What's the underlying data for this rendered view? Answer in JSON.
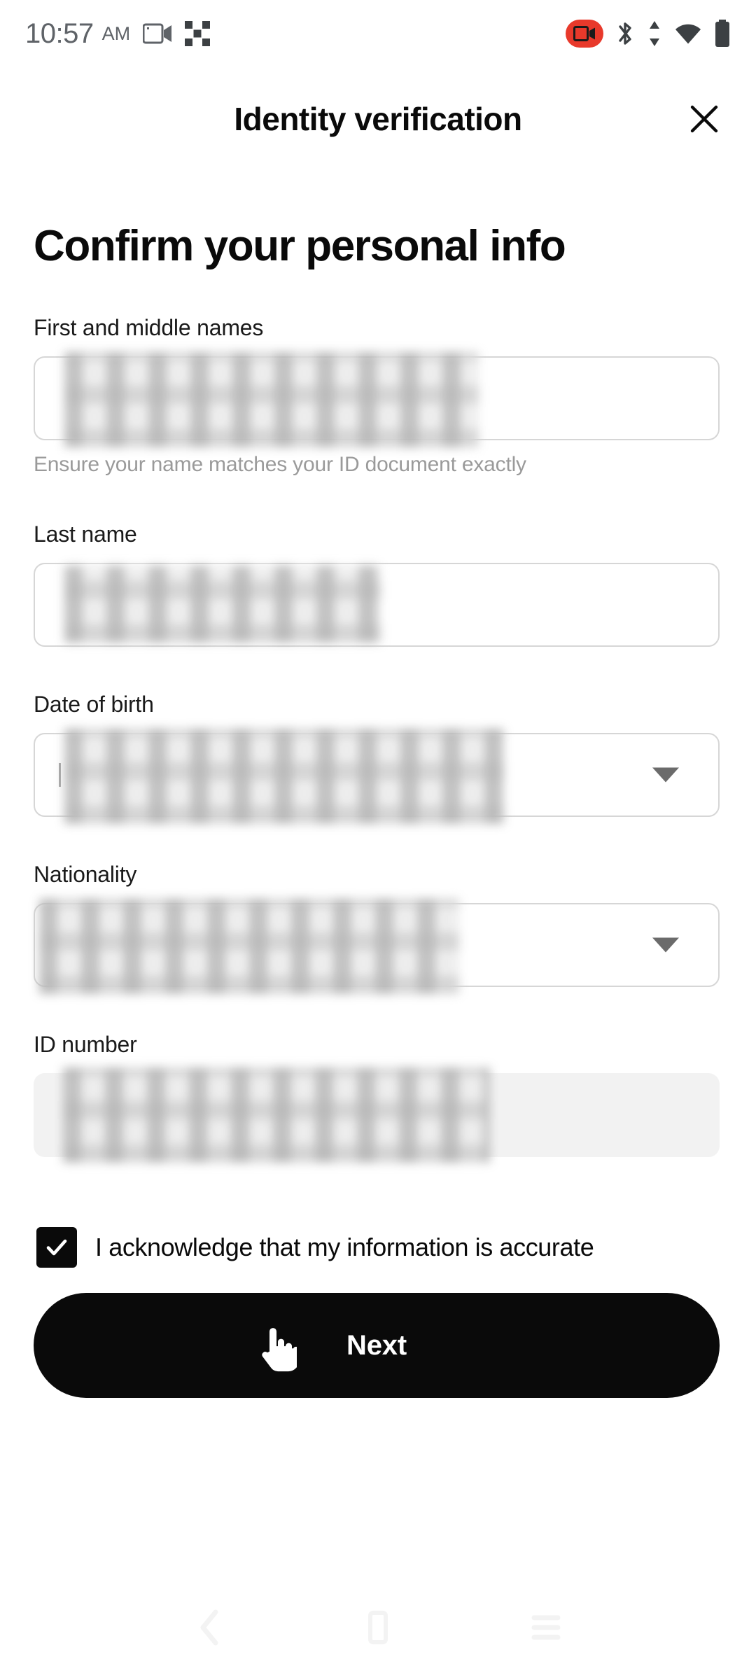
{
  "status_bar": {
    "time": "10:57",
    "ampm": "AM",
    "left_icons": [
      "screen-record-icon",
      "fragment-icon"
    ],
    "right_icons": [
      "screen-record-active-badge-icon",
      "bluetooth-icon",
      "data-transfer-icon",
      "wifi-icon",
      "battery-icon"
    ],
    "record_badge_color": "#e8392b"
  },
  "header": {
    "title": "Identity verification",
    "close_icon": "close-icon"
  },
  "page": {
    "heading": "Confirm your personal info"
  },
  "form": {
    "fields": [
      {
        "label": "First and middle names",
        "value": "",
        "redacted": true,
        "redact_width": 592,
        "helper": "Ensure your name matches your ID document exactly",
        "type": "text",
        "name": "first-and-middle-names",
        "disabled": false
      },
      {
        "label": "Last name",
        "value": "",
        "redacted": true,
        "redact_width": 452,
        "helper": "",
        "type": "text",
        "name": "last-name",
        "disabled": false
      },
      {
        "label": "Date of birth",
        "value": "",
        "redacted": true,
        "redact_width": 628,
        "helper": "",
        "type": "select",
        "name": "date-of-birth",
        "disabled": false
      },
      {
        "label": "Nationality",
        "value": "",
        "redacted": true,
        "redact_width": 540,
        "helper": "",
        "type": "select",
        "name": "nationality",
        "disabled": false
      },
      {
        "label": "ID number",
        "value": "",
        "redacted": true,
        "redact_width": 610,
        "helper": "",
        "type": "text",
        "name": "id-number",
        "disabled": true
      }
    ]
  },
  "acknowledgement": {
    "label": "I acknowledge that my information is accurate",
    "checked": true,
    "check_icon": "check-icon"
  },
  "primary_action": {
    "label": "Next",
    "background": "#0a0a0a",
    "text_color": "#ffffff",
    "cursor_icon": "pointing-hand-cursor"
  },
  "nav_bar": {
    "items": [
      {
        "name": "back",
        "icon": "back-icon"
      },
      {
        "name": "home",
        "icon": "home-icon"
      },
      {
        "name": "recents",
        "icon": "recents-icon"
      }
    ]
  }
}
